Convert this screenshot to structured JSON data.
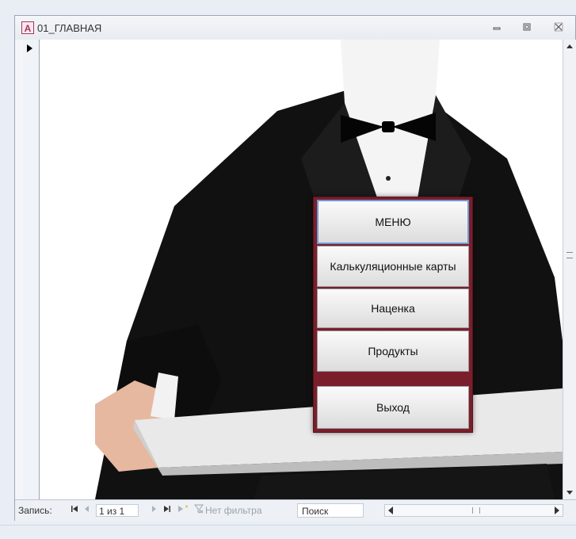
{
  "window": {
    "app_icon": "A",
    "title": "01_ГЛАВНАЯ",
    "controls": {
      "minimize": "minimize-icon",
      "restore": "restore-icon",
      "close": "close-icon"
    }
  },
  "menu": {
    "buttons": [
      {
        "label": "МЕНЮ"
      },
      {
        "label": "Калькуляционные карты"
      },
      {
        "label": "Наценка"
      },
      {
        "label": "Продукты"
      },
      {
        "label": "Выход"
      }
    ]
  },
  "navigation": {
    "record_label": "Запись:",
    "record_value": "1 из 1",
    "filter_label": "Нет фильтра",
    "search_placeholder": "Поиск"
  },
  "colors": {
    "panel": "#7a1e2c",
    "accent_icon": "#a4375b"
  }
}
